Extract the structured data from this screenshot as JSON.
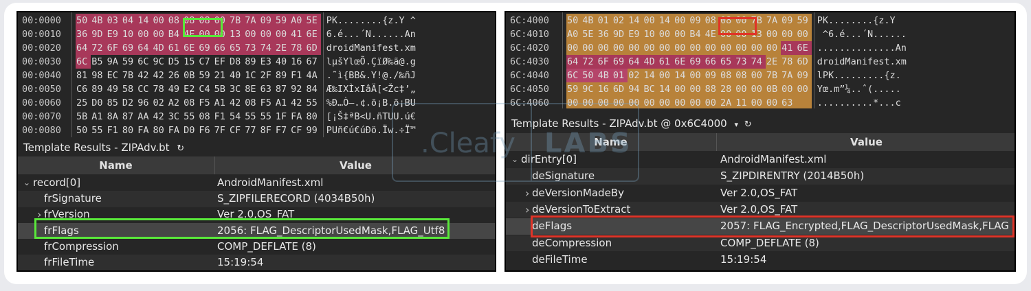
{
  "colors": {
    "panel_bg": "#262626",
    "pink": "#a8385a",
    "pink_light": "#b5456a",
    "orange": "#b8823a",
    "green_box": "#59e83a",
    "red_box": "#e03428"
  },
  "left": {
    "hex_rows": [
      {
        "addr": "00:0000",
        "bytes": [
          "50",
          "4B",
          "03",
          "04",
          "14",
          "00",
          "08",
          "08",
          "08",
          "00",
          "7B",
          "7A",
          "09",
          "59",
          "A0",
          "5E"
        ],
        "ascii": "PK........{z.Y ^"
      },
      {
        "addr": "00:0010",
        "bytes": [
          "36",
          "9D",
          "E9",
          "10",
          "00",
          "00",
          "B4",
          "4E",
          "00",
          "00",
          "13",
          "00",
          "00",
          "00",
          "41",
          "6E"
        ],
        "ascii": "6.é...´N......An"
      },
      {
        "addr": "00:0020",
        "bytes": [
          "64",
          "72",
          "6F",
          "69",
          "64",
          "4D",
          "61",
          "6E",
          "69",
          "66",
          "65",
          "73",
          "74",
          "2E",
          "78",
          "6D"
        ],
        "ascii": "droidManifest.xm"
      },
      {
        "addr": "00:0030",
        "bytes": [
          "6C",
          "B5",
          "9A",
          "59",
          "6C",
          "9C",
          "D5",
          "15",
          "C7",
          "EF",
          "D8",
          "89",
          "E3",
          "40",
          "16",
          "67"
        ],
        "ascii": "lµšYlœÕ.ÇïØ‰ã@.g"
      },
      {
        "addr": "00:0040",
        "bytes": [
          "81",
          "98",
          "EC",
          "7B",
          "42",
          "42",
          "26",
          "0B",
          "59",
          "21",
          "40",
          "1C",
          "2F",
          "89",
          "F1",
          "4A"
        ],
        "ascii": ".˜ì{BB&.Y!@./‰ñJ"
      },
      {
        "addr": "00:0050",
        "bytes": [
          "C6",
          "89",
          "49",
          "58",
          "CC",
          "78",
          "49",
          "E2",
          "C4",
          "5B",
          "3C",
          "8E",
          "63",
          "87",
          "92",
          "84"
        ],
        "ascii": "Æ‰IXÌxIâÄ[<Žc‡’„"
      },
      {
        "addr": "00:0060",
        "bytes": [
          "25",
          "D0",
          "85",
          "D2",
          "96",
          "02",
          "A2",
          "08",
          "F5",
          "A1",
          "42",
          "08",
          "F5",
          "A1",
          "42",
          "55"
        ],
        "ascii": "%Ð…Ò–.¢.õ¡B.õ¡BU"
      },
      {
        "addr": "00:0070",
        "bytes": [
          "5B",
          "A1",
          "8A",
          "87",
          "AA",
          "42",
          "3C",
          "55",
          "08",
          "F1",
          "54",
          "55",
          "55",
          "1F",
          "FA",
          "80"
        ],
        "ascii": "[¡Š‡ªB<U.ñTUU.ú€"
      },
      {
        "addr": "00:0080",
        "bytes": [
          "50",
          "55",
          "F1",
          "80",
          "FA",
          "80",
          "FA",
          "D0",
          "F6",
          "7F",
          "CF",
          "77",
          "8F",
          "F7",
          "CF",
          "99"
        ],
        "ascii": "PUñ€ú€úÐö.Ïw.÷Ï™"
      }
    ],
    "template_title": "Template Results - ZIPAdv.bt",
    "refresh_icon": "refresh-icon",
    "col_name": "Name",
    "col_value": "Value",
    "rows": [
      {
        "name": "record[0]",
        "value": "AndroidManifest.xml",
        "arrow": "expanded"
      },
      {
        "name": "frSignature",
        "value": "S_ZIPFILERECORD (4034B50h)",
        "arrow": ""
      },
      {
        "name": "frVersion",
        "value": "Ver 2.0,OS_FAT",
        "arrow": "collapsed"
      },
      {
        "name": "frFlags",
        "value": "2056: FLAG_DescriptorUsedMask,FLAG_Utf8",
        "arrow": ""
      },
      {
        "name": "frCompression",
        "value": "COMP_DEFLATE (8)",
        "arrow": ""
      },
      {
        "name": "frFileTime",
        "value": "15:19:54",
        "arrow": ""
      }
    ]
  },
  "right": {
    "hex_rows": [
      {
        "addr": "6C:4000",
        "bytes": [
          "50",
          "4B",
          "01",
          "02",
          "14",
          "00",
          "14",
          "00",
          "09",
          "08",
          "08",
          "00",
          "7B",
          "7A",
          "09",
          "59"
        ],
        "ascii": "PK........{z.Y"
      },
      {
        "addr": "6C:4010",
        "bytes": [
          "A0",
          "5E",
          "36",
          "9D",
          "E9",
          "10",
          "00",
          "00",
          "B4",
          "4E",
          "00",
          "00",
          "13",
          "00",
          "00",
          "00"
        ],
        "ascii": " ^6.é...´N......"
      },
      {
        "addr": "6C:4020",
        "bytes": [
          "00",
          "00",
          "00",
          "00",
          "00",
          "00",
          "00",
          "00",
          "00",
          "00",
          "00",
          "00",
          "00",
          "00",
          "41",
          "6E"
        ],
        "ascii": "..............An"
      },
      {
        "addr": "6C:4030",
        "bytes": [
          "64",
          "72",
          "6F",
          "69",
          "64",
          "4D",
          "61",
          "6E",
          "69",
          "66",
          "65",
          "73",
          "74",
          "2E",
          "78",
          "6D"
        ],
        "ascii": "droidManifest.xm"
      },
      {
        "addr": "6C:4040",
        "bytes": [
          "6C",
          "50",
          "4B",
          "01",
          "02",
          "14",
          "00",
          "14",
          "00",
          "09",
          "08",
          "08",
          "00",
          "7B",
          "7A",
          "09"
        ],
        "ascii": "lPK.........{z."
      },
      {
        "addr": "6C:4050",
        "bytes": [
          "59",
          "9C",
          "16",
          "6D",
          "94",
          "BC",
          "14",
          "00",
          "00",
          "88",
          "28",
          "00",
          "00",
          "0B",
          "00",
          "00"
        ],
        "ascii": "Yœ.m”¼..ˆ(....."
      },
      {
        "addr": "6C:4060",
        "bytes": [
          "00",
          "00",
          "00",
          "00",
          "00",
          "00",
          "00",
          "00",
          "00",
          "00",
          "2A",
          "11",
          "00",
          "00",
          "63",
          ""
        ],
        "ascii": "..........*...c"
      }
    ],
    "template_title": "Template Results - ZIPAdv.bt @ 0x6C4000",
    "dropdown_icon": "chevron-down-icon",
    "refresh_icon": "refresh-icon",
    "col_name": "Name",
    "col_value": "Value",
    "rows": [
      {
        "name": "dirEntry[0]",
        "value": "AndroidManifest.xml",
        "arrow": "expanded"
      },
      {
        "name": "deSignature",
        "value": "S_ZIPDIRENTRY (2014B50h)",
        "arrow": ""
      },
      {
        "name": "deVersionMadeBy",
        "value": "Ver 2.0,OS_FAT",
        "arrow": "collapsed"
      },
      {
        "name": "deVersionToExtract",
        "value": "Ver 2.0,OS_FAT",
        "arrow": "collapsed"
      },
      {
        "name": "deFlags",
        "value": "2057: FLAG_Encrypted,FLAG_DescriptorUsedMask,FLAG",
        "arrow": ""
      },
      {
        "name": "deCompression",
        "value": "COMP_DEFLATE (8)",
        "arrow": ""
      },
      {
        "name": "deFileTime",
        "value": "15:19:54",
        "arrow": ""
      }
    ]
  },
  "watermark": {
    "part1": ".Cleafy",
    "part2": "LABS"
  }
}
